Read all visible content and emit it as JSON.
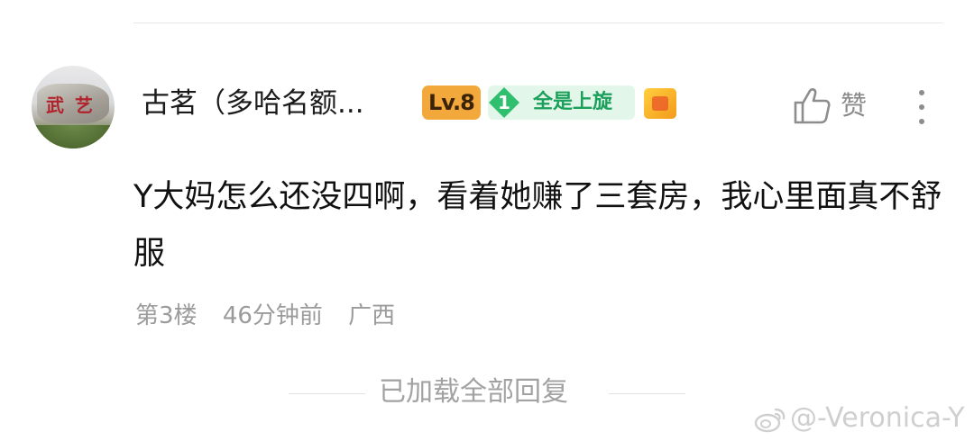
{
  "comment": {
    "user": {
      "name": "古茗（多哈名额...",
      "level": "Lv.8",
      "fan_badge_level": "1",
      "fan_badge_label": "全是上旋"
    },
    "text": "Y大妈怎么还没四啊，看着她赚了三套房，我心里面真不舒服",
    "floor": "第3楼",
    "time": "46分钟前",
    "location": "广西",
    "like_label": "赞"
  },
  "footer": {
    "loaded_all": "已加载全部回复"
  },
  "watermark": {
    "text": "@-Veronica-Y"
  },
  "colors": {
    "level_badge": "#f2a83a",
    "fan_badge_bg": "#e2f6ea",
    "fan_badge_accent": "#2fbf6f",
    "secondary_text": "#9b9b9b"
  },
  "icons": [
    "avatar",
    "thumbs-up-icon",
    "more-vertical-icon",
    "medal-icon",
    "weibo-icon"
  ]
}
